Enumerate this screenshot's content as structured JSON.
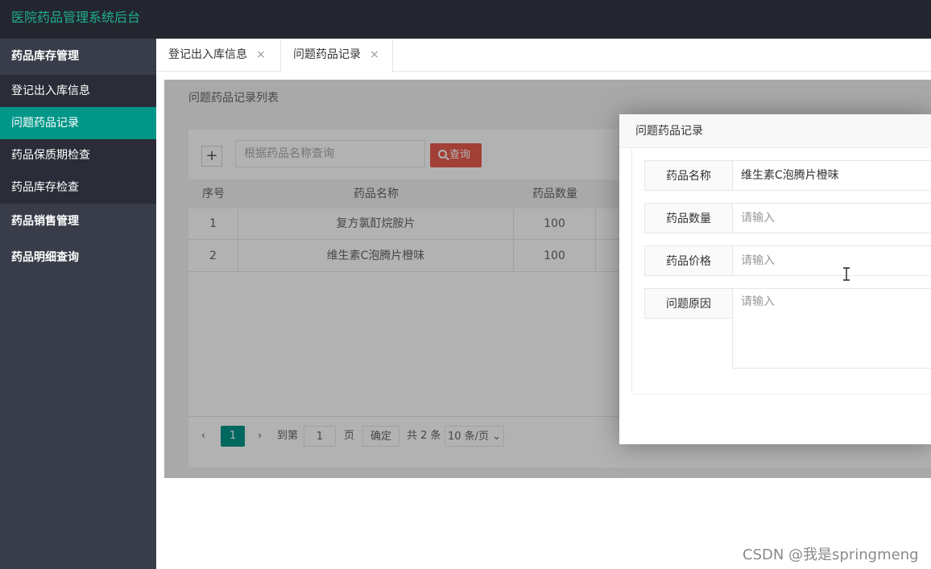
{
  "header": {
    "app_title": "医院药品管理系统后台"
  },
  "sidebar": {
    "groups": [
      {
        "label": "药品库存管理",
        "items": [
          {
            "label": "登记出入库信息",
            "active": false
          },
          {
            "label": "问题药品记录",
            "active": true
          },
          {
            "label": "药品保质期检查",
            "active": false
          },
          {
            "label": "药品库存检查",
            "active": false
          }
        ]
      },
      {
        "label": "药品销售管理"
      },
      {
        "label": "药品明细查询"
      }
    ]
  },
  "tabs": [
    {
      "label": "登记出入库信息",
      "close": "×"
    },
    {
      "label": "问题药品记录",
      "close": "×",
      "active": true
    }
  ],
  "panel": {
    "title": "问题药品记录列表",
    "add_button": "+",
    "search_placeholder": "根据药品名称查询",
    "search_button": "查询"
  },
  "table": {
    "columns": [
      "序号",
      "药品名称",
      "药品数量"
    ],
    "rows": [
      [
        "1",
        "复方氯酊烷胺片",
        "100"
      ],
      [
        "2",
        "维生素C泡腾片橙味",
        "100"
      ]
    ]
  },
  "pagination": {
    "prev": "‹",
    "current_page": "1",
    "next": "›",
    "goto_prefix": "到第",
    "goto_value": "1",
    "goto_suffix": "页",
    "confirm": "确定",
    "total": "共 2 条",
    "page_size": "10 条/页"
  },
  "modal": {
    "title": "问题药品记录",
    "fields": [
      {
        "label": "药品名称",
        "value": "维生素C泡腾片橙味",
        "placeholder": ""
      },
      {
        "label": "药品数量",
        "value": "",
        "placeholder": "请输入"
      },
      {
        "label": "药品价格",
        "value": "",
        "placeholder": "请输入"
      },
      {
        "label": "问题原因",
        "value": "",
        "placeholder": "请输入"
      }
    ]
  },
  "watermark": "CSDN @我是springmeng",
  "colors": {
    "accent": "#009688",
    "header_bg": "#23262e",
    "sidebar_bg": "#393d49",
    "danger": "#e85b4e"
  }
}
